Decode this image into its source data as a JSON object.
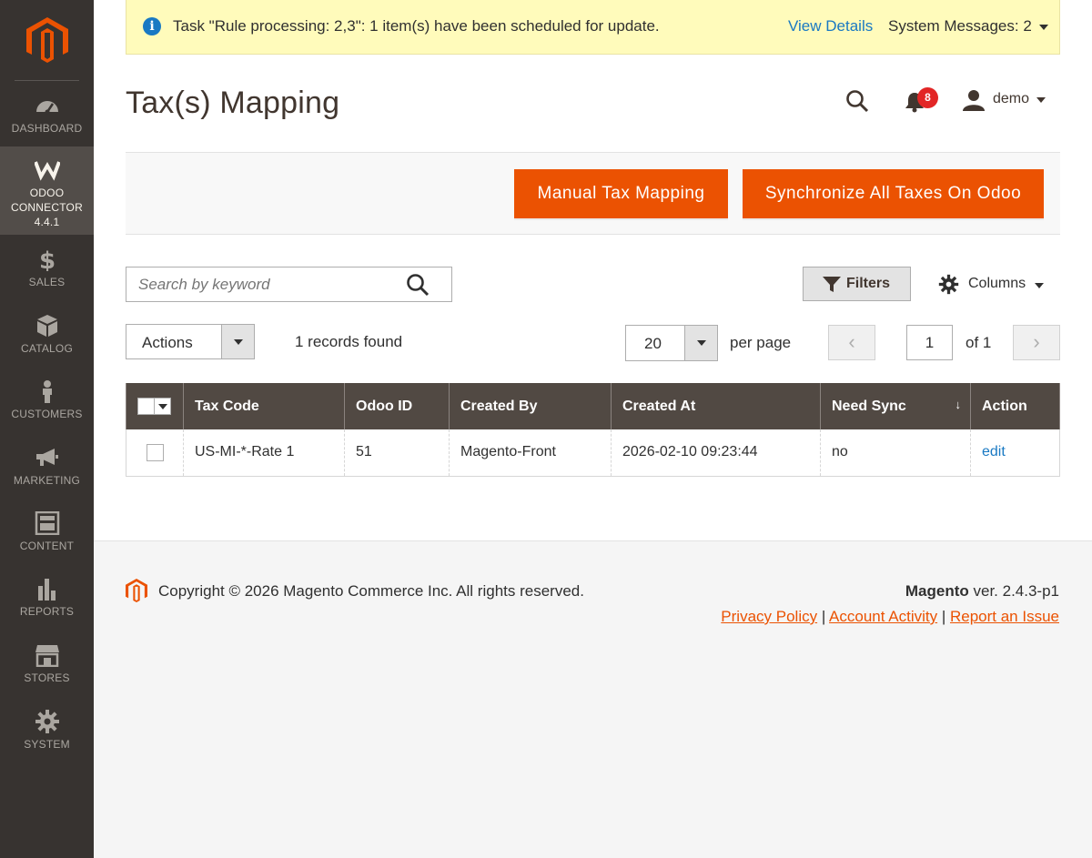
{
  "sidebar": {
    "items": [
      {
        "label": "Dashboard",
        "icon": "dashboard-icon"
      },
      {
        "label": "Odoo Connector 4.4.1",
        "icon": "odoo-connector-icon"
      },
      {
        "label": "Sales",
        "icon": "dollar-icon"
      },
      {
        "label": "Catalog",
        "icon": "cube-icon"
      },
      {
        "label": "Customers",
        "icon": "person-icon"
      },
      {
        "label": "Marketing",
        "icon": "megaphone-icon"
      },
      {
        "label": "Content",
        "icon": "layout-icon"
      },
      {
        "label": "Reports",
        "icon": "bar-chart-icon"
      },
      {
        "label": "Stores",
        "icon": "storefront-icon"
      },
      {
        "label": "System",
        "icon": "gear-icon"
      }
    ],
    "active": "Odoo Connector 4.4.1"
  },
  "message": {
    "text": "Task \"Rule processing: 2,3\": 1 item(s) have been scheduled for update.",
    "link": "View Details",
    "system": "System Messages: 2"
  },
  "header": {
    "title": "Tax(s) Mapping",
    "notifications": "8",
    "user": "demo"
  },
  "actions": {
    "manual": "Manual Tax Mapping",
    "sync": "Synchronize All Taxes On Odoo"
  },
  "toolbar": {
    "search_placeholder": "Search by keyword",
    "filters": "Filters",
    "columns": "Columns",
    "mass_action": "Actions",
    "records": "1 records found",
    "per_page": "20",
    "per_page_label": "per page",
    "page": "1",
    "of": "of 1"
  },
  "grid": {
    "columns": [
      "Tax Code",
      "Odoo ID",
      "Created By",
      "Created At",
      "Need Sync",
      "Action"
    ],
    "rows": [
      {
        "tax_code": "US-MI-*-Rate 1",
        "odoo_id": "51",
        "created_by": "Magento-Front",
        "created_at": "2026-02-10 09:23:44",
        "need_sync": "no",
        "action": "edit"
      }
    ]
  },
  "footer": {
    "copyright": "Copyright © 2026 Magento Commerce Inc. All rights reserved.",
    "brand": "Magento",
    "version": " ver. 2.4.3-p1",
    "links": [
      "Privacy Policy",
      "Account Activity",
      "Report an Issue"
    ]
  },
  "colors": {
    "accent": "#eb5202",
    "sidebar": "#373330",
    "grid_header": "#514943",
    "link": "#1979c3"
  }
}
